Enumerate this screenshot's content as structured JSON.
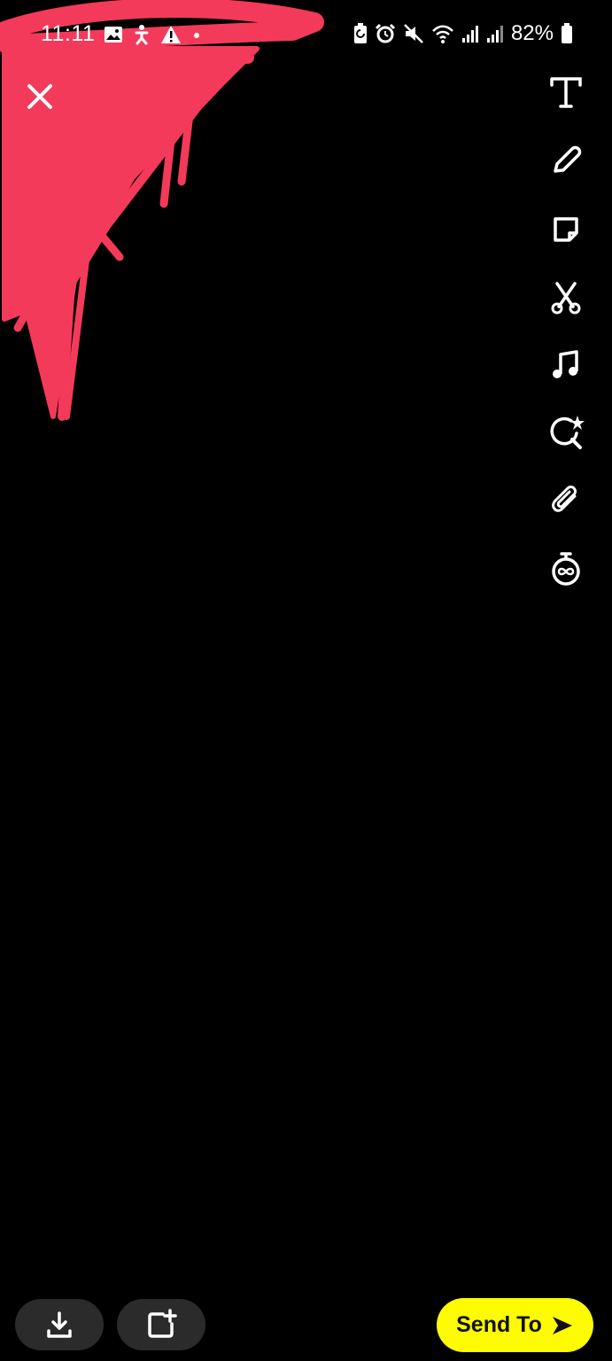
{
  "status_bar": {
    "time": "11:11",
    "battery": "82%",
    "left_icons": [
      "image-icon",
      "accessibility-icon",
      "warning-icon",
      "dot-icon"
    ],
    "right_icons": [
      "battery-saver-icon",
      "alarm-icon",
      "mute-icon",
      "wifi-icon",
      "signal-icon",
      "signal-icon",
      "battery-icon"
    ]
  },
  "doodle": {
    "color": "#f43a5a"
  },
  "toolbar": {
    "tools": [
      {
        "icon": "text-icon"
      },
      {
        "icon": "pencil-icon"
      },
      {
        "icon": "sticker-icon"
      },
      {
        "icon": "scissors-icon"
      },
      {
        "icon": "music-icon"
      },
      {
        "icon": "lens-search-icon"
      },
      {
        "icon": "paperclip-icon"
      },
      {
        "icon": "timer-icon"
      }
    ]
  },
  "close": {
    "icon": "close-icon"
  },
  "bottom": {
    "save_icon": "download-icon",
    "story_icon": "add-story-icon",
    "send_label": "Send To",
    "send_color": "#fffc00"
  }
}
